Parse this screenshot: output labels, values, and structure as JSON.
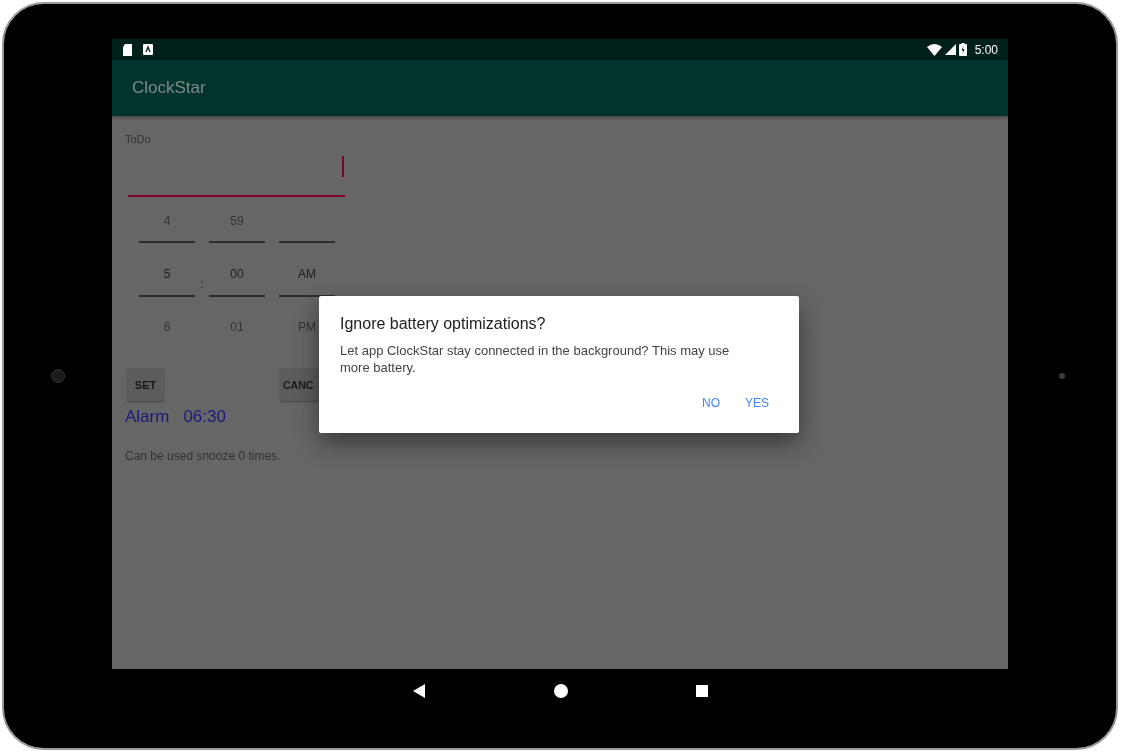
{
  "status_bar": {
    "time": "5:00"
  },
  "app_bar": {
    "title": "ClockStar"
  },
  "todo_field": {
    "label": "ToDo",
    "focused": true
  },
  "time_picker": {
    "separator": ":",
    "columns": [
      {
        "previous": "4",
        "current": "5",
        "next": "6"
      },
      {
        "previous": "59",
        "current": "00",
        "next": "01"
      },
      {
        "current": "AM",
        "next": "PM"
      }
    ]
  },
  "buttons": [
    "SET",
    "CANC"
  ],
  "alarm": {
    "label": "Alarm",
    "time": "06:30"
  },
  "snooze_note": "Can be used snooze 0 times.",
  "dialog": {
    "title": "Ignore battery optimizations?",
    "message": "Let app ClockStar stay connected in the background? This may use more battery.",
    "buttons": [
      "NO",
      "YES"
    ]
  }
}
